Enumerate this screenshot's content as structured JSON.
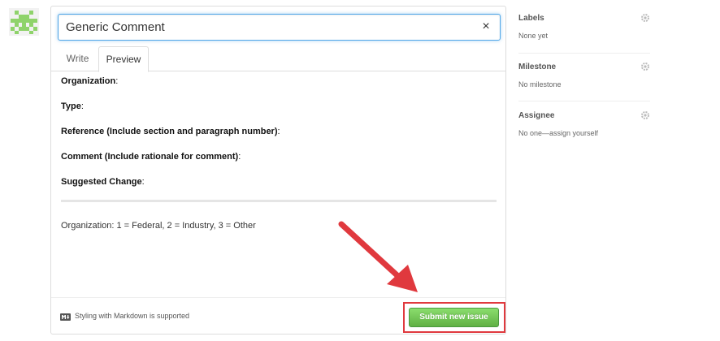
{
  "issue": {
    "title_value": "Generic Comment",
    "clear_symbol": "×",
    "tabs": [
      {
        "label": "Write",
        "active": false
      },
      {
        "label": "Preview",
        "active": true
      }
    ],
    "preview": {
      "fields": [
        {
          "label": "Organization",
          "suffix": ":"
        },
        {
          "label": "Type",
          "suffix": ":"
        },
        {
          "label": "Reference (Include section and paragraph number)",
          "suffix": ":"
        },
        {
          "label": "Comment (Include rationale for comment)",
          "suffix": ":"
        },
        {
          "label": "Suggested Change",
          "suffix": ":"
        }
      ],
      "note": "Organization: 1 = Federal, 2 = Industry, 3 = Other"
    },
    "footer": {
      "markdown_icon": "markdown-icon",
      "markdown_text": "Styling with Markdown is supported",
      "submit_label": "Submit new issue"
    }
  },
  "sidebar": {
    "sections": [
      {
        "heading": "Labels",
        "value": "None yet",
        "icon": "gear-icon"
      },
      {
        "heading": "Milestone",
        "value": "No milestone",
        "icon": "gear-icon"
      },
      {
        "heading": "Assignee",
        "value": "No one—assign yourself",
        "icon": "gear-icon"
      }
    ]
  },
  "colors": {
    "submit_green": "#60b044",
    "focus_blue": "#51a7e8",
    "annotation_red": "#e0393e",
    "avatar_green": "#8fd36b"
  }
}
